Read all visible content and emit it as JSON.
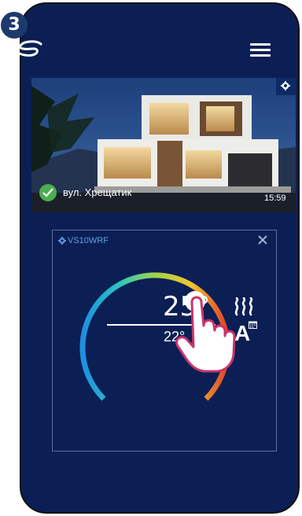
{
  "step": "3",
  "header": {
    "logo": "salus-logo-icon",
    "menu": "hamburger-menu-icon"
  },
  "location": {
    "address": "вул. Хрещатик",
    "time": "15:59",
    "status": "online"
  },
  "device": {
    "name": "VS10WRF",
    "current_temp": "25°",
    "set_temp": "22°",
    "mode": "A",
    "heating": "heat-waves-icon"
  }
}
